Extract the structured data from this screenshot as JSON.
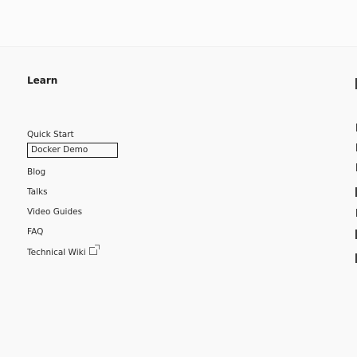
{
  "nav": {
    "title": "Learn",
    "items": [
      {
        "label": "Quick Start"
      },
      {
        "label": "Docker Demo"
      },
      {
        "label": "Blog"
      },
      {
        "label": "Talks"
      },
      {
        "label": "Video Guides"
      },
      {
        "label": "FAQ"
      },
      {
        "label": "Technical Wiki"
      }
    ]
  },
  "icons": {
    "external": "external-link-icon"
  },
  "colors": {
    "text": "#2b2b2b",
    "title": "#1f1f1f",
    "focus_border": "#1f1f1f"
  }
}
